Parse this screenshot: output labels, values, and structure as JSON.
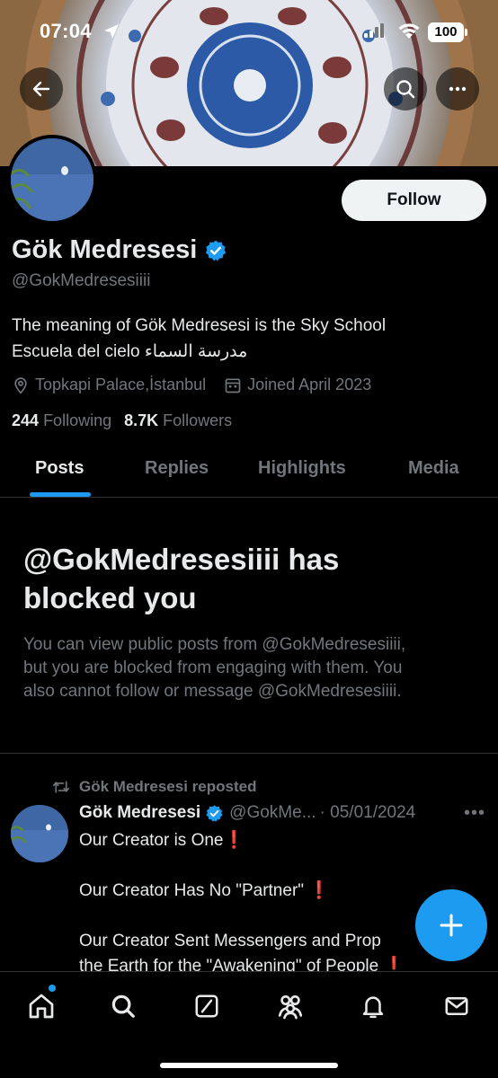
{
  "status_bar": {
    "time": "07:04",
    "battery": "100"
  },
  "profile": {
    "display_name": "Gök Medresesi",
    "handle": "@GokMedresesiiii",
    "bio_line1": "The meaning of Gök Medresesi is the Sky School",
    "bio_line2": "Escuela del cielo مدرسة السماء",
    "location": "Topkapi Palace,İstanbul",
    "joined": "Joined April 2023",
    "following_count": "244",
    "following_label": "Following",
    "followers_count": "8.7K",
    "followers_label": "Followers",
    "follow_button": "Follow"
  },
  "tabs": [
    "Posts",
    "Replies",
    "Highlights",
    "Media"
  ],
  "blocked_notice": {
    "title_line1": "@GokMedresesiiii has",
    "title_line2": "blocked you",
    "body_line1": "You can view public posts from @GokMedresesiiii,",
    "body_line2": "but you are blocked from engaging with them. You",
    "body_line3": "also cannot follow or message @GokMedresesiiii."
  },
  "post": {
    "repost_label": "Gök Medresesi reposted",
    "author_name": "Gök Medresesi",
    "author_handle": "@GokMe...",
    "date": "· 05/01/2024",
    "line1": "Our Creator is One",
    "line2": "Our Creator Has No \"Partner\"",
    "line3": "Our Creator Sent Messengers and Prop",
    "line4": "the Earth for the \"Awakening\" of People",
    "excl": "❗"
  },
  "icons": {
    "back": "back-arrow-icon",
    "search": "search-icon",
    "more": "more-icon",
    "verified": "verified-badge-icon",
    "location": "location-pin-icon",
    "calendar": "calendar-icon",
    "repost": "repost-icon",
    "compose": "compose-plus-icon",
    "nav": [
      "home-icon",
      "search-icon",
      "grok-icon",
      "communities-icon",
      "notifications-icon",
      "messages-icon"
    ]
  },
  "colors": {
    "accent": "#1d9bf0",
    "background": "#000000",
    "muted": "#71767b",
    "text": "#e7e9ea"
  }
}
